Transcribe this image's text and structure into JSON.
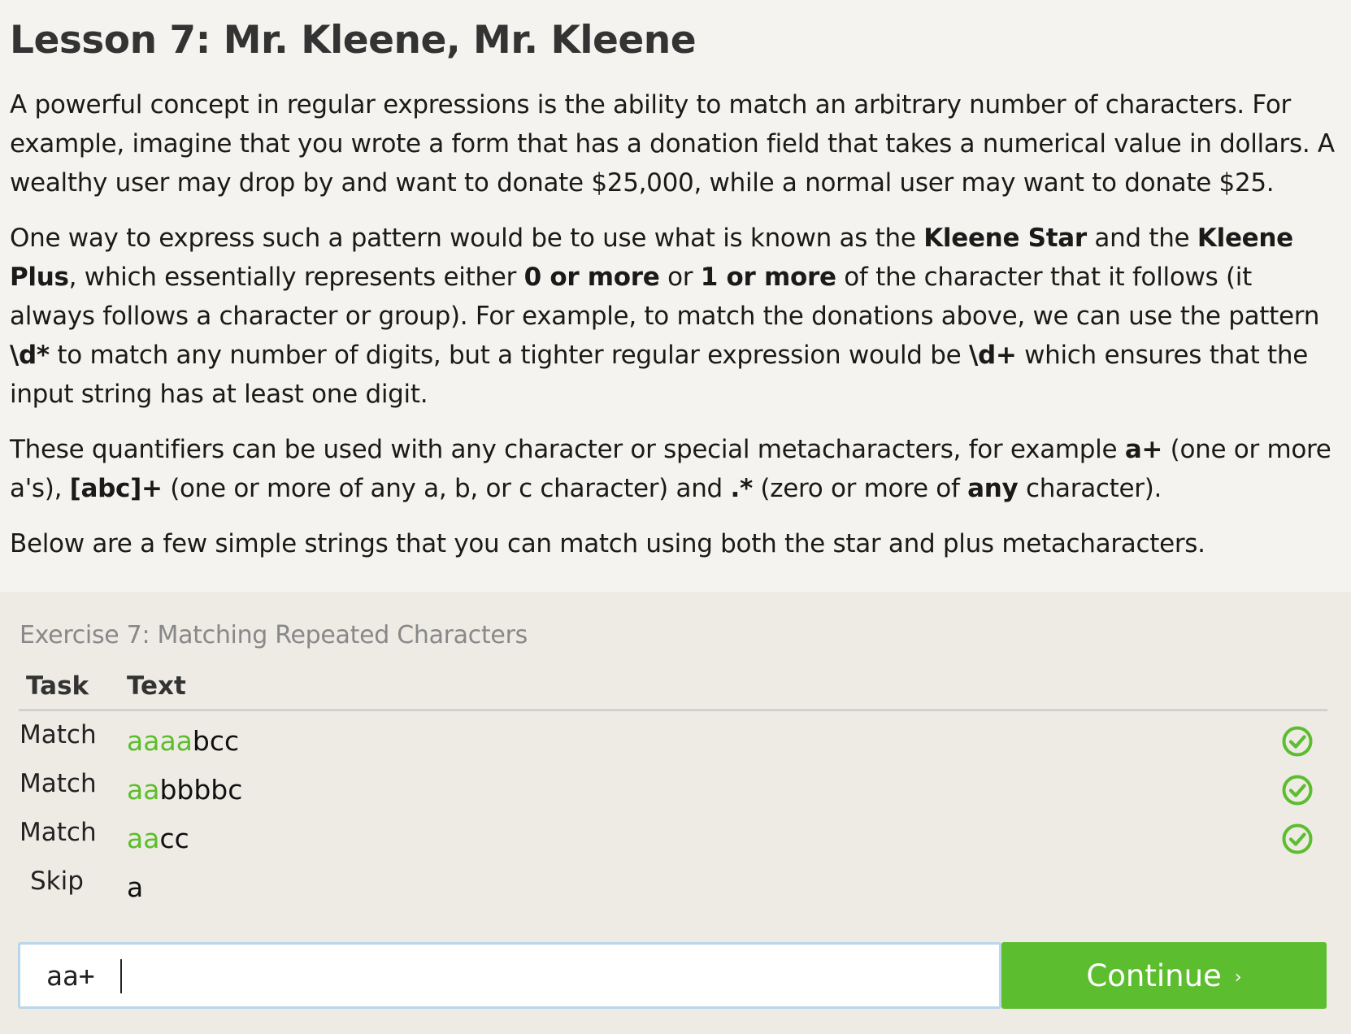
{
  "lesson": {
    "title": "Lesson 7: Mr. Kleene, Mr. Kleene",
    "p1": "A powerful concept in regular expressions is the ability to match an arbitrary number of characters. For example, imagine that you wrote a form that has a donation field that takes a numerical value in dollars. A wealthy user may drop by and want to donate $25,000, while a normal user may want to donate $25.",
    "p2": [
      "One way to express such a pattern would be to use what is known as the ",
      "Kleene Star",
      " and the ",
      "Kleene Plus",
      ", which essentially represents either ",
      "0 or more",
      " or ",
      "1 or more",
      " of the character that it follows (it always follows a character or group). For example, to match the donations above, we can use the pattern ",
      "\\d*",
      " to match any number of digits, but a tighter regular expression would be ",
      "\\d+",
      " which ensures that the input string has at least one digit."
    ],
    "p3": [
      "These quantifiers can be used with any character or special metacharacters, for example ",
      "a+",
      " (one or more a's), ",
      "[abc]+",
      " (one or more of any a, b, or c character) and ",
      ".*",
      " (zero or more of ",
      "any",
      " character)."
    ],
    "p4": "Below are a few simple strings that you can match using both the star and plus metacharacters."
  },
  "exercise": {
    "title": "Exercise 7: Matching Repeated Characters",
    "col_task": "Task",
    "col_text": "Text",
    "rows": [
      {
        "task": "Match",
        "matched": "aaaa",
        "rest": "bcc",
        "status": "check-circle-icon"
      },
      {
        "task": "Match",
        "matched": "aa",
        "rest": "bbbbc",
        "status": "check-circle-icon"
      },
      {
        "task": "Match",
        "matched": "aa",
        "rest": "cc",
        "status": "check-circle-icon"
      },
      {
        "task": "Skip",
        "matched": "",
        "rest": "a",
        "status": ""
      }
    ],
    "input_value": "aa+",
    "continue_label": "Continue",
    "continue_chevron": "›"
  },
  "colors": {
    "accent_green": "#5cbd2e",
    "page_bg": "#f5f3ef",
    "exercise_bg": "#edebe4",
    "input_border": "#b9d6ea"
  }
}
